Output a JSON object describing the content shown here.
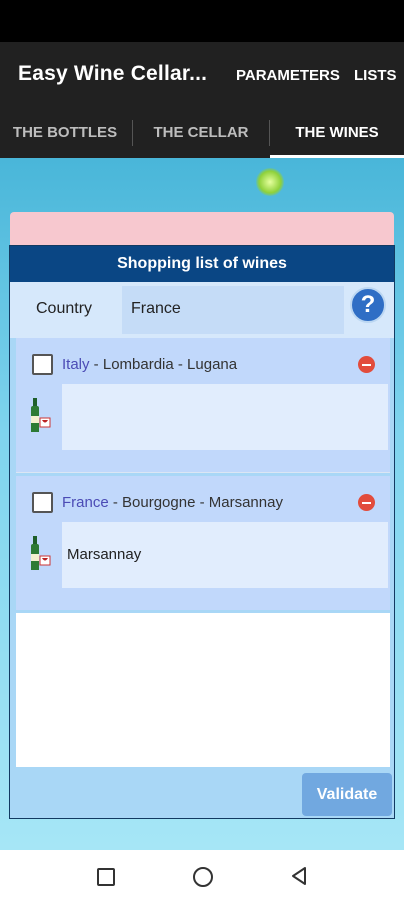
{
  "app": {
    "title": "Easy Wine Cellar...",
    "menu": {
      "parameters": "PARAMETERS",
      "lists": "LISTS"
    }
  },
  "tabs": [
    {
      "label": "THE BOTTLES",
      "active": false
    },
    {
      "label": "THE CELLAR",
      "active": false
    },
    {
      "label": "THE WINES",
      "active": true
    }
  ],
  "dialog": {
    "title": "Shopping list of wines",
    "country_label": "Country",
    "country_value": "France",
    "help_icon": "question-mark-icon",
    "items": [
      {
        "checked": false,
        "country": "Italy",
        "details": " - Lombardia - Lugana",
        "note": "",
        "icon": "wine-bottle-icon"
      },
      {
        "checked": false,
        "country": "France",
        "details": " - Bourgogne - Marsannay",
        "note": "Marsannay",
        "icon": "wine-bottle-icon"
      }
    ],
    "validate_label": "Validate"
  },
  "colors": {
    "header_bg": "#0a4684",
    "dialog_bg": "#a9d7f6",
    "item_bg": "#c1d8fb",
    "accent_link": "#4b4bb5",
    "remove": "#e24c3c",
    "validate": "#71a8e0"
  }
}
